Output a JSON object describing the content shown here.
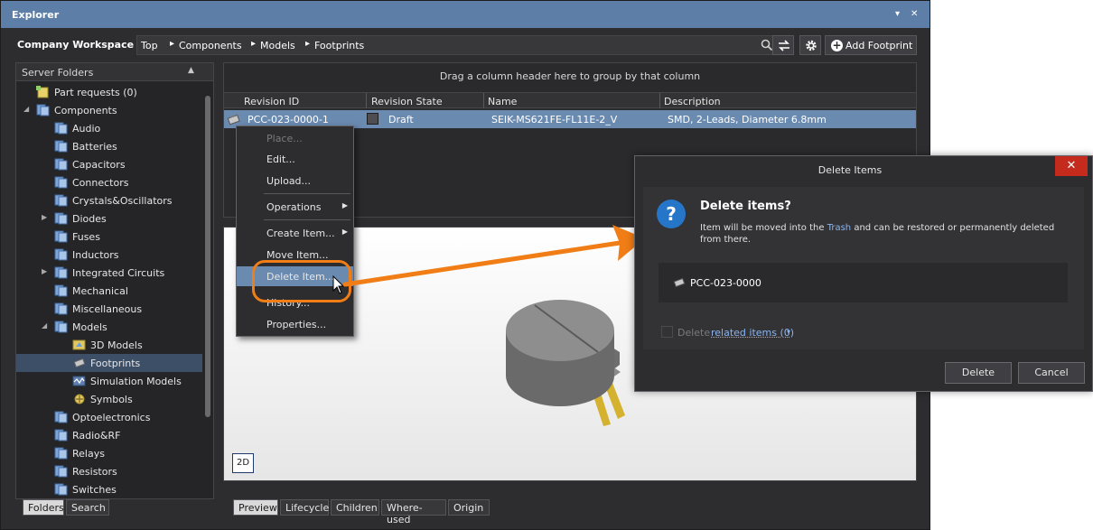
{
  "window": {
    "title": "Explorer",
    "pin_glyph": "▾",
    "close_glyph": "✕"
  },
  "navbar": {
    "workspace": "Company Workspace ▾",
    "breadcrumb": [
      "Top",
      "Components",
      "Models",
      "Footprints"
    ],
    "crumb_sep": "▸",
    "add_button": "Add Footprint"
  },
  "folders": {
    "header": "Server Folders",
    "items": [
      {
        "label": "Part requests (0)",
        "expander": ""
      },
      {
        "label": "Components",
        "expander": "◢"
      },
      {
        "label": "Audio",
        "expander": ""
      },
      {
        "label": "Batteries",
        "expander": ""
      },
      {
        "label": "Capacitors",
        "expander": ""
      },
      {
        "label": "Connectors",
        "expander": ""
      },
      {
        "label": "Crystals&Oscillators",
        "expander": ""
      },
      {
        "label": "Diodes",
        "expander": "▶"
      },
      {
        "label": "Fuses",
        "expander": ""
      },
      {
        "label": "Inductors",
        "expander": ""
      },
      {
        "label": "Integrated Circuits",
        "expander": "▶"
      },
      {
        "label": "Mechanical",
        "expander": ""
      },
      {
        "label": "Miscellaneous",
        "expander": ""
      },
      {
        "label": "Models",
        "expander": "◢"
      },
      {
        "label": "3D Models",
        "expander": ""
      },
      {
        "label": "Footprints",
        "expander": ""
      },
      {
        "label": "Simulation Models",
        "expander": ""
      },
      {
        "label": "Symbols",
        "expander": ""
      },
      {
        "label": "Optoelectronics",
        "expander": ""
      },
      {
        "label": "Radio&RF",
        "expander": ""
      },
      {
        "label": "Relays",
        "expander": ""
      },
      {
        "label": "Resistors",
        "expander": ""
      },
      {
        "label": "Switches",
        "expander": ""
      }
    ]
  },
  "left_tabs": [
    "Folders",
    "Search"
  ],
  "grid": {
    "group_hint": "Drag a column header here to group by that column",
    "columns": [
      "Revision ID",
      "Revision State",
      "Name",
      "Description"
    ],
    "row": {
      "revision_id": "PCC-023-0000-1",
      "state": "Draft",
      "name": "SEIK-MS621FE-FL11E-2_V",
      "description": "SMD, 2-Leads, Diameter 6.8mm"
    }
  },
  "context_menu": {
    "items": [
      "Place...",
      "Edit...",
      "Upload...",
      "Operations",
      "Create Item...",
      "Move Item...",
      "Delete Item...",
      "History...",
      "Properties..."
    ],
    "submenu_arrow": "▶"
  },
  "preview": {
    "mode_button": "2D"
  },
  "bottom_tabs": [
    "Preview",
    "Lifecycle",
    "Children",
    "Where-used",
    "Origin"
  ],
  "dialog": {
    "title": "Delete Items",
    "close_glyph": "✕",
    "icon_glyph": "?",
    "heading": "Delete items?",
    "msg_before": "Item will be moved into the ",
    "msg_link": "Trash",
    "msg_after": " and can be restored or permanently deleted from there.",
    "item": "PCC-023-0000",
    "related_prefix": "Delete",
    "related_link": "related items (0)",
    "related_dropdown": "▾",
    "delete_button": "Delete",
    "cancel_button": "Cancel"
  },
  "colors": {
    "accent_orange": "#f07d16",
    "title_blue": "#5d7ea6",
    "selection_blue": "#6a8ab0",
    "dialog_close_red": "#c42b1c"
  }
}
